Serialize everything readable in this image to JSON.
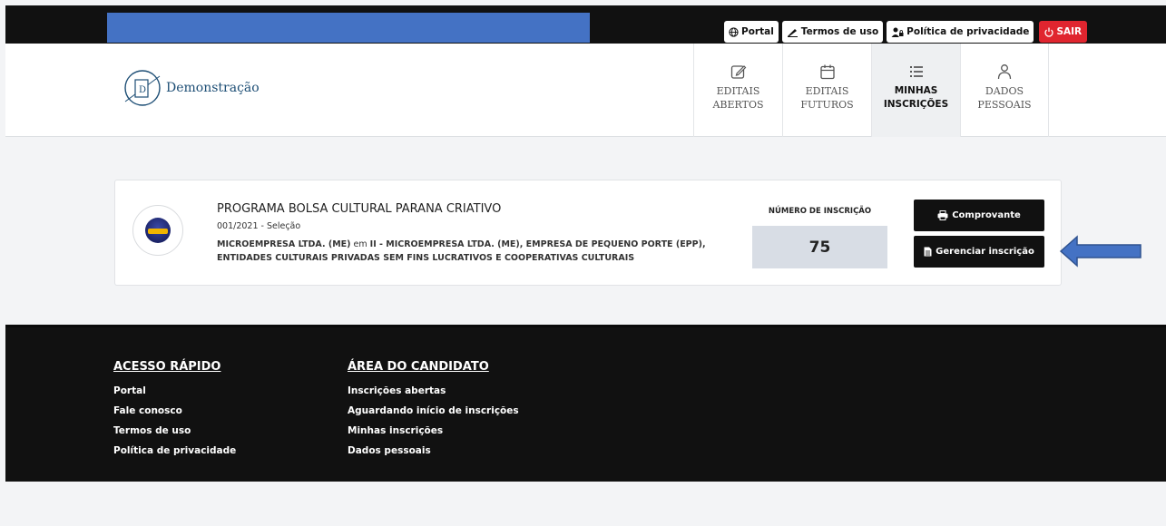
{
  "topbar": {
    "links": [
      {
        "icon": "globe-icon",
        "label": "Portal"
      },
      {
        "icon": "signature-icon",
        "label": "Termos de uso"
      },
      {
        "icon": "user-lock-icon",
        "label": "Política de privacidade"
      }
    ],
    "logout_label": "SAIR",
    "logout_color": "#e0252f",
    "redaction_color": "#4472c4"
  },
  "header": {
    "logo_letter": "D",
    "logo_text": "Demonstração",
    "nav": [
      {
        "icon": "edit-icon",
        "label1": "EDITAIS",
        "label2": "ABERTOS",
        "active": false
      },
      {
        "icon": "calendar-icon",
        "label1": "EDITAIS",
        "label2": "FUTUROS",
        "active": false
      },
      {
        "icon": "list-icon",
        "label1": "MINHAS",
        "label2": "INSCRIÇÕES",
        "active": true
      },
      {
        "icon": "user-icon",
        "label1": "DADOS",
        "label2": "PESSOAIS",
        "active": false
      }
    ]
  },
  "inscription": {
    "program_title": "PROGRAMA BOLSA CULTURAL PARANA CRIATIVO",
    "edital": "001/2021 - Seleção",
    "category": "MICROEMPRESA LTDA. (ME)",
    "connector": "em",
    "line": "II - MICROEMPRESA LTDA. (ME), EMPRESA DE PEQUENO PORTE (EPP),",
    "line2": "ENTIDADES CULTURAIS PRIVADAS SEM FINS LUCRATIVOS E COOPERATIVAS CULTURAIS",
    "number_label": "NÚMERO DE INSCRIÇÃO",
    "number": "75",
    "receipt_button": "Comprovante",
    "manage_button": "Gerenciar inscrição"
  },
  "footer": {
    "quick_access": {
      "title": "ACESSO RÁPIDO",
      "items": [
        "Portal",
        "Fale conosco",
        "Termos de uso",
        "Política de privacidade"
      ]
    },
    "candidate_area": {
      "title": "ÁREA DO CANDIDATO",
      "items": [
        "Inscrições abertas",
        "Aguardando início de inscrições",
        "Minhas inscrições",
        "Dados pessoais"
      ]
    }
  }
}
